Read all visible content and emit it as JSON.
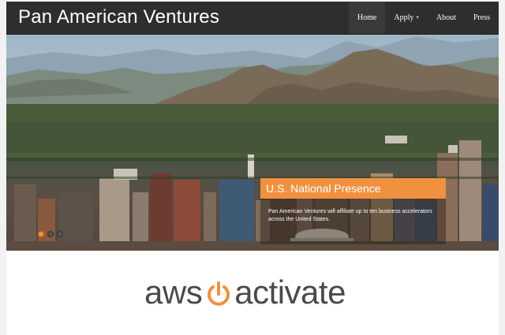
{
  "header": {
    "brand": "Pan American Ventures",
    "nav": [
      {
        "label": "Home"
      },
      {
        "label": "Apply"
      },
      {
        "label": "About"
      },
      {
        "label": "Press"
      }
    ]
  },
  "hero": {
    "caption_title": "U.S. National Presence",
    "caption_body": "Pan American Ventures will affiliate up to ten business accelerators across the United States.",
    "slides": 3,
    "active_slide": 1
  },
  "logo": {
    "left_text": "aws",
    "right_text": "activate",
    "accent_color": "#f0913f"
  },
  "colors": {
    "navbar": "#2e2e2e",
    "caption_orange": "#f0913f"
  }
}
